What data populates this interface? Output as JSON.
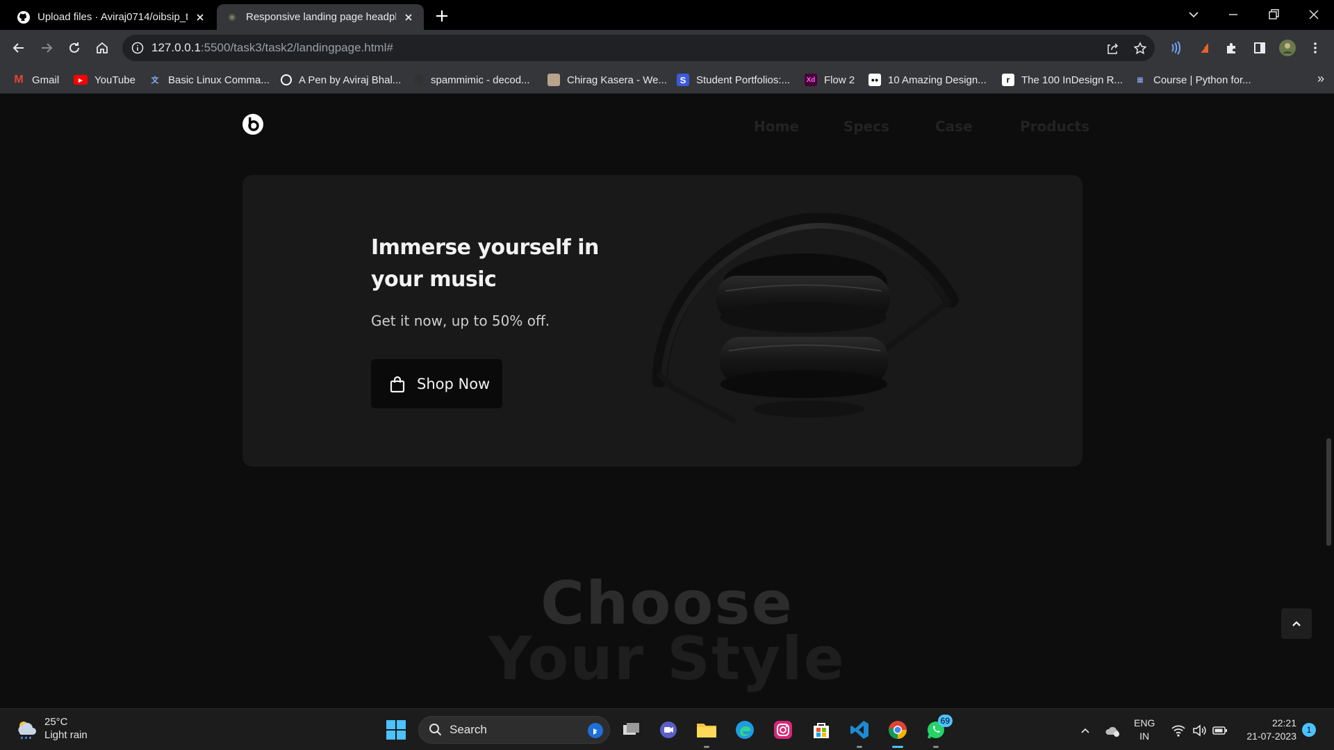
{
  "browser": {
    "tabs": [
      {
        "title": "Upload files · Aviraj0714/oibsip_t",
        "active": false,
        "icon": "github-icon"
      },
      {
        "title": "Responsive landing page headph",
        "active": true,
        "icon": "page-favicon-icon"
      }
    ],
    "address": {
      "host": "127.0.0.1",
      "rest": ":5500/task3/task2/landingpage.html#"
    },
    "bookmarks": [
      {
        "label": "Gmail",
        "icon": "gmail-icon"
      },
      {
        "label": "YouTube",
        "icon": "youtube-icon"
      },
      {
        "label": "Basic Linux Comma...",
        "icon": "translate-icon"
      },
      {
        "label": "A Pen by Aviraj Bhal...",
        "icon": "codepen-icon"
      },
      {
        "label": "spammimic - decod...",
        "icon": "spammimic-icon"
      },
      {
        "label": "Chirag Kasera - We...",
        "icon": "portrait-icon"
      },
      {
        "label": "Student Portfolios:...",
        "icon": "s-icon"
      },
      {
        "label": "Flow 2",
        "icon": "xd-icon"
      },
      {
        "label": "10 Amazing Design...",
        "icon": "medium-icon"
      },
      {
        "label": "The 100 InDesign R...",
        "icon": "r-icon"
      },
      {
        "label": "Course | Python for...",
        "icon": "course-icon"
      }
    ],
    "bookmarks_more": "»"
  },
  "site": {
    "nav": [
      "Home",
      "Specs",
      "Case",
      "Products"
    ],
    "hero": {
      "title": "Immerse yourself in your music",
      "subtitle": "Get it now, up to 50% off.",
      "cta": "Shop Now"
    },
    "section_heading": {
      "line1": "Choose",
      "line2": "Your Style"
    }
  },
  "taskbar": {
    "weather": {
      "temp": "25°C",
      "condition": "Light rain"
    },
    "search_label": "Search",
    "whatsapp_badge": "69",
    "language": {
      "line1": "ENG",
      "line2": "IN"
    },
    "time": "22:21",
    "date": "21-07-2023",
    "notification_count": "1"
  },
  "colors": {
    "page_bg": "#0d0d0d",
    "hero_card": "#191919",
    "accent_taskbar": "#4cc2ff"
  }
}
